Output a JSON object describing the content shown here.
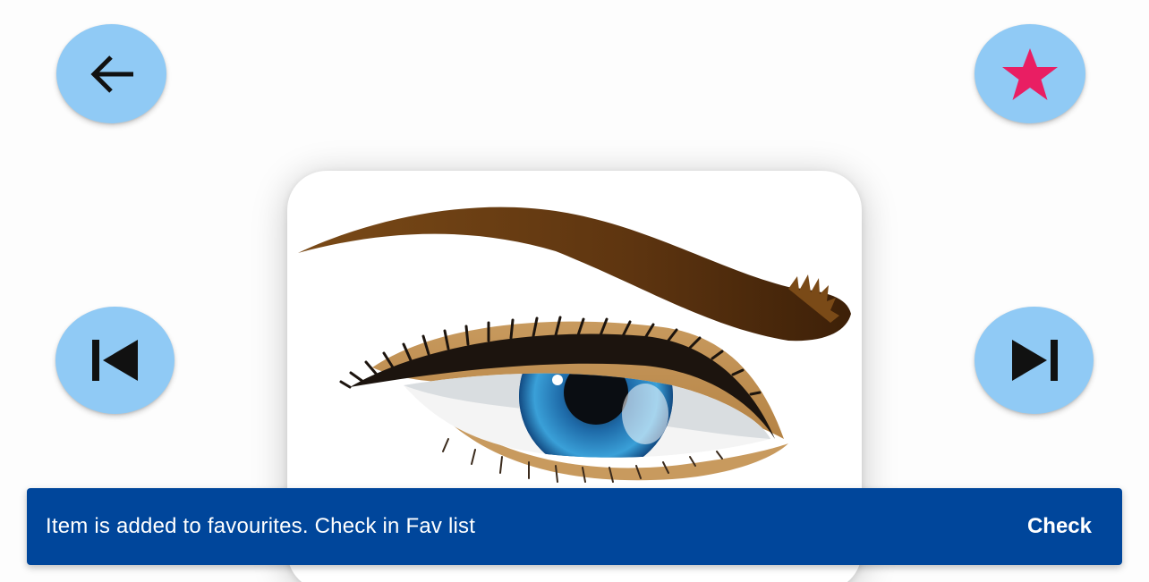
{
  "toolbar": {
    "back_icon": "arrow-back-icon",
    "favourite_icon": "star-icon",
    "favourite_color": "#e91e63",
    "button_color": "#90caf5"
  },
  "navigation": {
    "previous_icon": "skip-previous-icon",
    "next_icon": "skip-next-icon"
  },
  "content": {
    "image_subject": "eye-illustration"
  },
  "snackbar": {
    "message": "Item is added to favourites. Check in Fav list",
    "action_label": "Check",
    "background_color": "#00469b"
  }
}
